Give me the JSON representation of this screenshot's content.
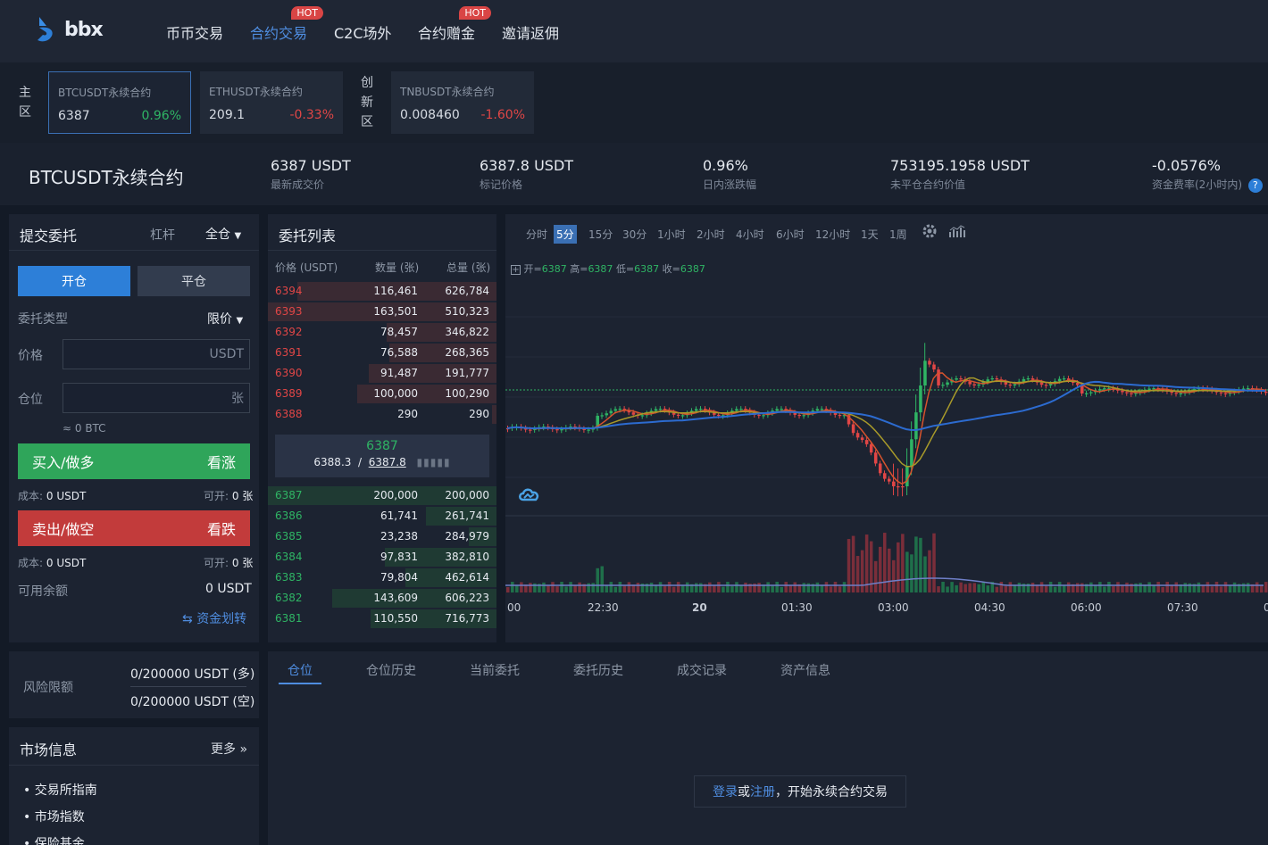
{
  "brand": {
    "name": "bbx"
  },
  "nav": [
    {
      "label": "币币交易",
      "hot": false
    },
    {
      "label": "合约交易",
      "hot": true,
      "active": true
    },
    {
      "label": "C2C场外",
      "hot": false
    },
    {
      "label": "合约赠金",
      "hot": true
    },
    {
      "label": "邀请返佣",
      "hot": false
    }
  ],
  "hot_label": "HOT",
  "zones": {
    "main": [
      "主",
      "区"
    ],
    "innovation": [
      "创",
      "新",
      "区"
    ]
  },
  "markets": [
    {
      "name": "BTCUSDT永续合约",
      "price": "6387",
      "change": "0.96%",
      "dir": "up"
    },
    {
      "name": "ETHUSDT永续合约",
      "price": "209.1",
      "change": "-0.33%",
      "dir": "dn"
    },
    {
      "name": "TNBUSDT永续合约",
      "price": "0.008460",
      "change": "-1.60%",
      "dir": "dn"
    }
  ],
  "ticker": {
    "symbol": "BTCUSDT永续合约",
    "stats": [
      {
        "value": "6387 USDT",
        "label": "最新成交价"
      },
      {
        "value": "6387.8 USDT",
        "label": "标记价格"
      },
      {
        "value": "0.96%",
        "label": "日内涨跌幅",
        "up": true
      },
      {
        "value": "753195.1958 USDT",
        "label": "未平仓合约价值"
      },
      {
        "value": "-0.0576%",
        "label": "资金费率(2小时内)"
      }
    ],
    "help_icon": "question-icon"
  },
  "order_form": {
    "title": "提交委托",
    "leverage": "杠杆",
    "margin_mode": "全仓",
    "open": "开仓",
    "close": "平仓",
    "type_label": "委托类型",
    "type_value": "限价",
    "price_label": "价格",
    "price_unit": "USDT",
    "qty_label": "仓位",
    "qty_unit": "张",
    "btc_est": "≈ 0 BTC",
    "buy": {
      "label": "买入/做多",
      "tag": "看涨"
    },
    "sell": {
      "label": "卖出/做空",
      "tag": "看跌"
    },
    "cost_label": "成本:",
    "cost_value": "0 USDT",
    "avail_label": "可开:",
    "avail_value": "0 张",
    "balance_label": "可用余额",
    "balance_value": "0 USDT",
    "transfer": "资金划转"
  },
  "orderbook": {
    "title": "委托列表",
    "headers": [
      "价格 (USDT)",
      "数量 (张)",
      "总量 (张)"
    ],
    "asks": [
      {
        "price": "6394",
        "qty": "116,461",
        "total": "626,784",
        "depth": 0.87
      },
      {
        "price": "6393",
        "qty": "163,501",
        "total": "510,323",
        "depth": 1.0
      },
      {
        "price": "6392",
        "qty": "78,457",
        "total": "346,822",
        "depth": 0.48
      },
      {
        "price": "6391",
        "qty": "76,588",
        "total": "268,365",
        "depth": 0.47
      },
      {
        "price": "6390",
        "qty": "91,487",
        "total": "191,777",
        "depth": 0.56
      },
      {
        "price": "6389",
        "qty": "100,000",
        "total": "100,290",
        "depth": 0.61
      },
      {
        "price": "6388",
        "qty": "290",
        "total": "290",
        "depth": 0.002
      }
    ],
    "last": "6387",
    "mark_index": "6388.3",
    "mark": "6387.8",
    "bids": [
      {
        "price": "6387",
        "qty": "200,000",
        "total": "200,000",
        "depth": 1.0
      },
      {
        "price": "6386",
        "qty": "61,741",
        "total": "261,741",
        "depth": 0.31
      },
      {
        "price": "6385",
        "qty": "23,238",
        "total": "284,979",
        "depth": 0.12
      },
      {
        "price": "6384",
        "qty": "97,831",
        "total": "382,810",
        "depth": 0.49
      },
      {
        "price": "6383",
        "qty": "79,804",
        "total": "462,614",
        "depth": 0.4
      },
      {
        "price": "6382",
        "qty": "143,609",
        "total": "606,223",
        "depth": 0.72
      },
      {
        "price": "6381",
        "qty": "110,550",
        "total": "716,773",
        "depth": 0.55
      }
    ]
  },
  "chart": {
    "timeframes": [
      "分时",
      "5分",
      "15分",
      "30分",
      "1小时",
      "2小时",
      "4小时",
      "6小时",
      "12小时",
      "1天",
      "1周"
    ],
    "selected": "5分",
    "ohlc": {
      "open_label": "开=",
      "open": "6387",
      "high_label": "高=",
      "high": "6387",
      "low_label": "低=",
      "low": "6387",
      "close_label": "收=",
      "close": "6387"
    },
    "xticks": [
      "00",
      "22:30",
      "20",
      "01:30",
      "03:00",
      "04:30",
      "06:00",
      "07:30",
      "0"
    ],
    "colors": {
      "up": "#2fb464",
      "down": "#e04646",
      "ma1": "#d6532d",
      "ma2": "#a89a2a",
      "ma3": "#2c6bd0"
    }
  },
  "chart_data": {
    "type": "candlestick",
    "x": [
      "22:30",
      "01:30",
      "03:00",
      "04:30",
      "06:00",
      "07:30"
    ],
    "close_approx": [
      6385,
      6384,
      6379,
      6392,
      6391,
      6388,
      6389,
      6387
    ],
    "last": 6387
  },
  "risk": {
    "label": "风险限额",
    "long": "0/200000 USDT (多)",
    "short": "0/200000 USDT (空)"
  },
  "market_info": {
    "title": "市场信息",
    "more": "更多 »",
    "items": [
      "交易所指南",
      "市场指数",
      "保险基金"
    ]
  },
  "tabs": [
    "仓位",
    "仓位历史",
    "当前委托",
    "委托历史",
    "成交记录",
    "资产信息"
  ],
  "login_prompt": {
    "login": "登录",
    "or": " 或 ",
    "register": "注册",
    "rest": "，开始永续合约交易"
  }
}
